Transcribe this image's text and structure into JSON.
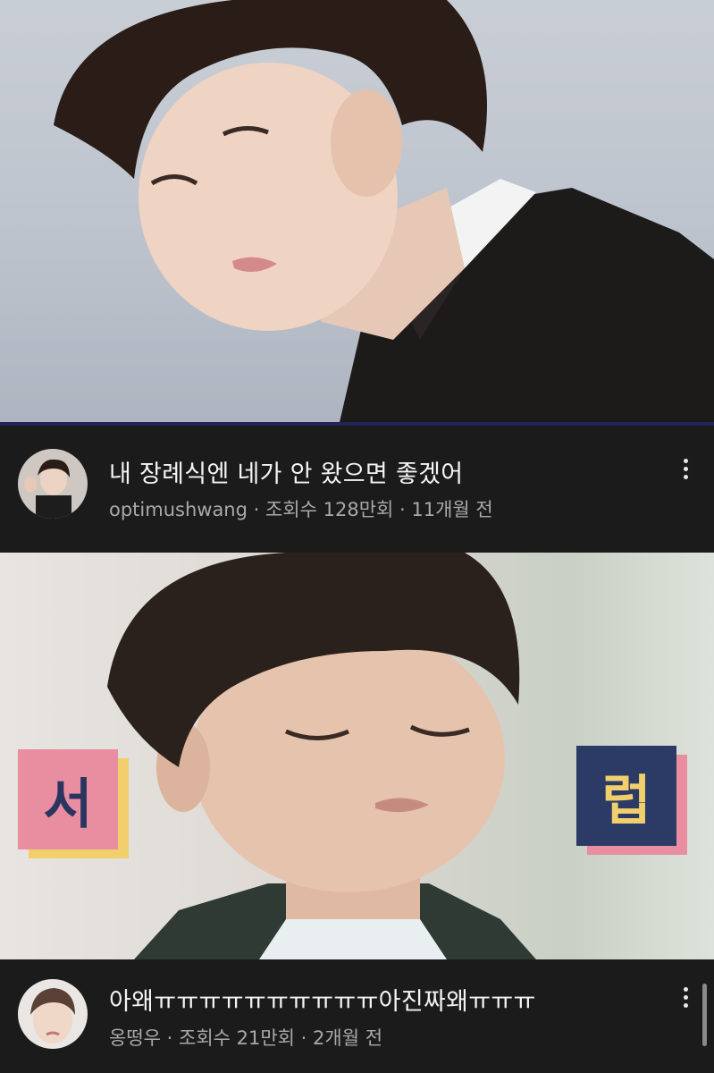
{
  "videos": [
    {
      "title": "내 장례식엔 네가 안 왔으면 좋겠어",
      "channel": "optimushwang",
      "views": "조회수 128만회",
      "age": "11개월 전",
      "separator": " · "
    },
    {
      "title": "아왜ㅠㅠㅠㅠㅠㅠㅠㅠㅠㅠ아진짜왜ㅠㅠㅠ",
      "channel": "옹떵우",
      "views": "조회수 21만회",
      "age": "2개월 전",
      "separator": " · ",
      "thumbnail_cards": {
        "left": "서",
        "right": "럽"
      }
    }
  ],
  "icons": {
    "menu": "more-vert-icon"
  },
  "colors": {
    "background": "#000000",
    "row": "#1b1b1b",
    "meta": "#a9a9a9",
    "card_pink": "#e98da1",
    "card_navy": "#2c3a66",
    "card_yellow": "#f1cf6c"
  }
}
